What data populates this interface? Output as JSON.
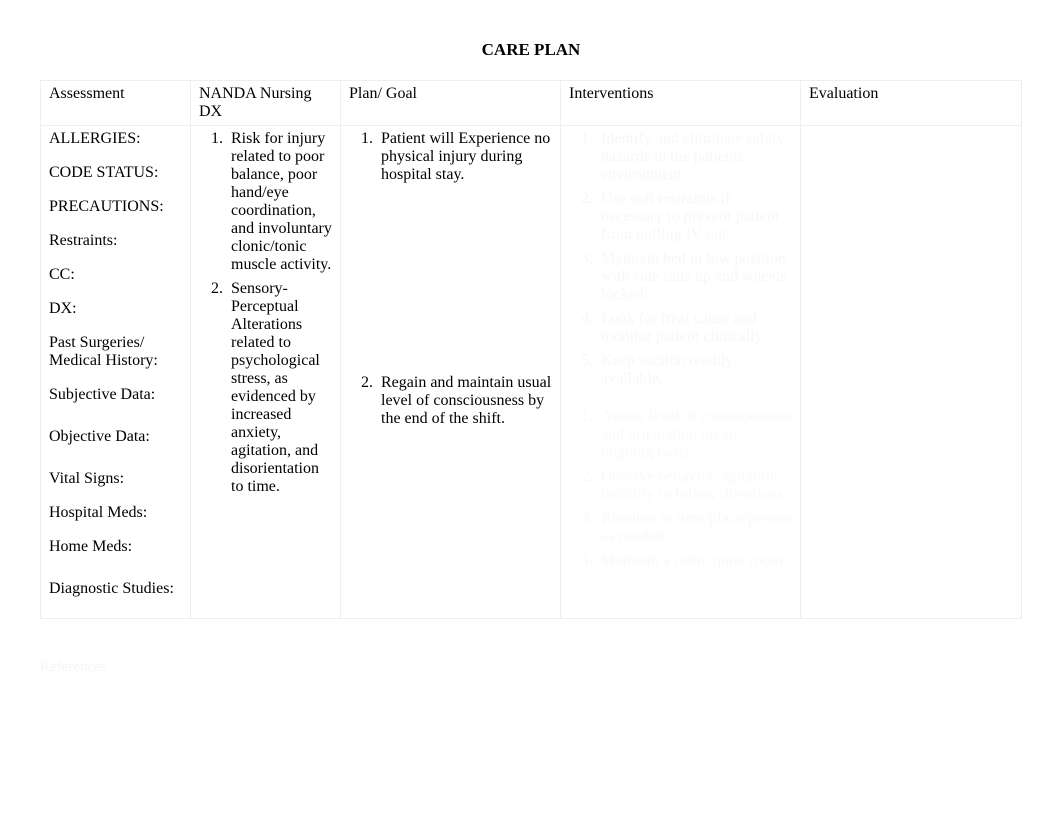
{
  "title": "CARE PLAN",
  "headers": {
    "assessment": "Assessment",
    "nanda": "NANDA Nursing DX",
    "plan": "Plan/ Goal",
    "interventions": "Interventions",
    "evaluation": "Evaluation"
  },
  "assessment": {
    "allergies": "ALLERGIES:",
    "code_status": "CODE STATUS:",
    "precautions": "PRECAUTIONS:",
    "restraints": "Restraints:",
    "cc": "CC:",
    "dx": "DX:",
    "past_surgeries": "Past Surgeries/ Medical History:",
    "subjective": "Subjective Data:",
    "objective": "Objective Data:",
    "vital_signs": "Vital Signs:",
    "hospital_meds": "Hospital Meds:",
    "home_meds": "Home Meds:",
    "diagnostic_studies": "Diagnostic Studies:"
  },
  "nanda_dx": [
    "Risk for injury related to poor balance, poor hand/eye coordination, and involuntary clonic/tonic muscle activity.",
    "Sensory-Perceptual Alterations related to psychological stress, as evidenced by increased anxiety, agitation, and disorientation to time."
  ],
  "plan_goals": [
    "Patient will Experience no physical injury during hospital stay.",
    "Regain and maintain usual level of consciousness by the end of the shift."
  ],
  "interventions_group1": [
    "Identify and eliminate safety hazards in the patients environment.",
    "Use soft restraints if necessary to prevent patient from pulling IV out.",
    "Maintain bed in low position with side rails up and wheels locked.",
    "Look for treat cause and monitor patient clinically.",
    "Keep suction readily available."
  ],
  "interventions_group2": [
    "Assess level of consciousness and orientation on an ongoing basis.",
    "Observe behavior, agitation, inability to follow directions.",
    "Reorient to time/place/person as needed.",
    "Maintain a calm, quiet room."
  ],
  "references_label": "References"
}
